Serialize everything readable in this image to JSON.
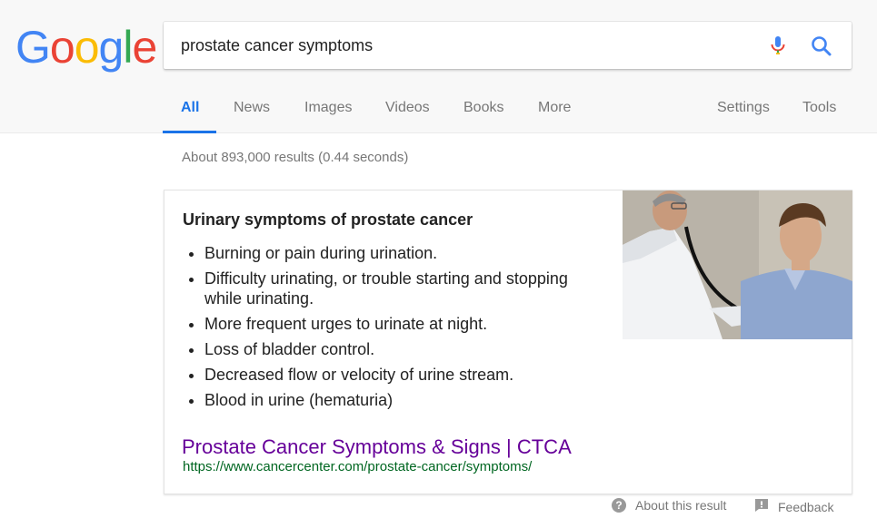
{
  "logo": {
    "letters": [
      "G",
      "o",
      "o",
      "g",
      "l",
      "e"
    ],
    "colors": [
      "#4285F4",
      "#EA4335",
      "#FBBC05",
      "#4285F4",
      "#34A853",
      "#EA4335"
    ]
  },
  "search": {
    "query": "prostate cancer symptoms",
    "icons": [
      "mic-icon",
      "search-icon"
    ]
  },
  "tabs": [
    "All",
    "News",
    "Images",
    "Videos",
    "Books",
    "More"
  ],
  "right_tabs": [
    "Settings",
    "Tools"
  ],
  "active_tab": "All",
  "stats": "About 893,000 results (0.44 seconds)",
  "snippet": {
    "title": "Urinary symptoms of prostate cancer",
    "items": [
      "Burning or pain during urination.",
      "Difficulty urinating, or trouble starting and stopping while urinating.",
      "More frequent urges to urinate at night.",
      "Loss of bladder control.",
      "Decreased flow or velocity of urine stream.",
      "Blood in urine (hematuria)"
    ],
    "result_title": "Prostate Cancer Symptoms & Signs | CTCA",
    "result_url": "https://www.cancercenter.com/prostate-cancer/symptoms/"
  },
  "footer": {
    "about": "About this result",
    "feedback": "Feedback"
  },
  "colors": {
    "accent": "#1a73e8",
    "visited_link": "#660099",
    "url": "#006621"
  }
}
